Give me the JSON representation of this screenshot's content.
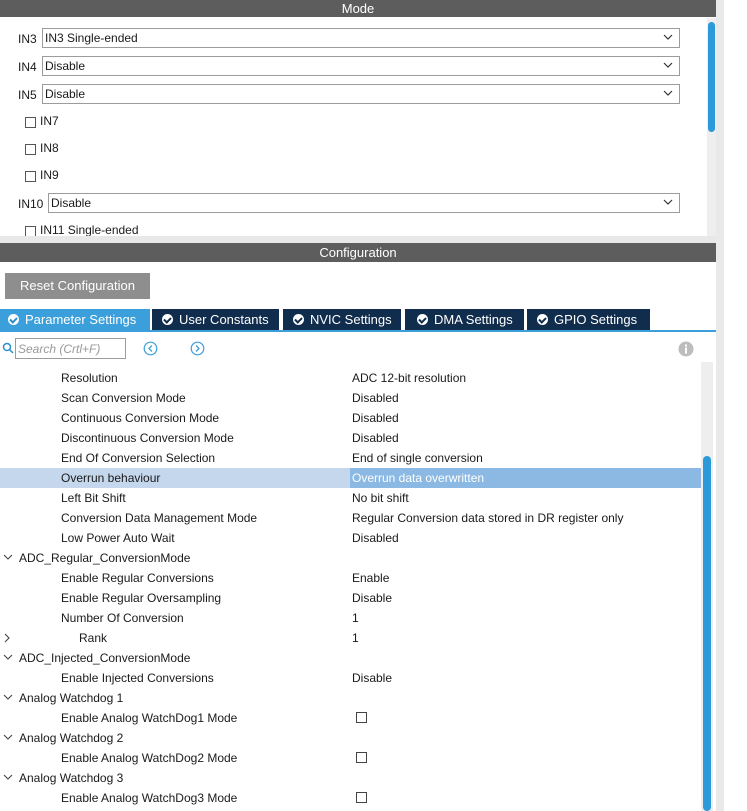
{
  "mode": {
    "title": "Mode",
    "selects": [
      {
        "label": "IN3",
        "value": "IN3 Single-ended"
      },
      {
        "label": "IN4",
        "value": "Disable"
      },
      {
        "label": "IN5",
        "value": "Disable"
      },
      {
        "label": "IN10",
        "value": "Disable"
      }
    ],
    "checkboxes": [
      {
        "label": "IN7",
        "checked": false
      },
      {
        "label": "IN8",
        "checked": false
      },
      {
        "label": "IN9",
        "checked": false
      },
      {
        "label": "IN11 Single-ended",
        "checked": false
      }
    ]
  },
  "config": {
    "title": "Configuration",
    "reset_label": "Reset Configuration",
    "tabs": [
      {
        "label": "Parameter Settings",
        "active": true
      },
      {
        "label": "User Constants",
        "active": false
      },
      {
        "label": "NVIC Settings",
        "active": false
      },
      {
        "label": "DMA Settings",
        "active": false
      },
      {
        "label": "GPIO Settings",
        "active": false
      }
    ],
    "search_placeholder": "Search (Crtl+F)"
  },
  "params": [
    {
      "name": "Resolution",
      "value": "ADC 12-bit resolution"
    },
    {
      "name": "Scan Conversion Mode",
      "value": "Disabled"
    },
    {
      "name": "Continuous Conversion Mode",
      "value": "Disabled"
    },
    {
      "name": "Discontinuous Conversion Mode",
      "value": "Disabled"
    },
    {
      "name": "End Of Conversion Selection",
      "value": "End of single conversion"
    },
    {
      "name": "Overrun behaviour",
      "value": "Overrun data overwritten",
      "selected": true
    },
    {
      "name": "Left Bit Shift",
      "value": "No bit shift"
    },
    {
      "name": "Conversion Data Management Mode",
      "value": "Regular Conversion data stored in DR register only"
    },
    {
      "name": "Low Power Auto Wait",
      "value": "Disabled"
    },
    {
      "group": "ADC_Regular_ConversionMode",
      "expanded": true
    },
    {
      "name": "Enable Regular Conversions",
      "value": "Enable"
    },
    {
      "name": "Enable Regular Oversampling",
      "value": "Disable"
    },
    {
      "name": "Number Of Conversion",
      "value": "1"
    },
    {
      "subgroup": "Rank",
      "value": "1",
      "expanded": false
    },
    {
      "group": "ADC_Injected_ConversionMode",
      "expanded": true
    },
    {
      "name": "Enable Injected Conversions",
      "value": "Disable"
    },
    {
      "group": "Analog Watchdog 1",
      "expanded": true
    },
    {
      "name": "Enable Analog WatchDog1 Mode",
      "checkbox": true,
      "checked": false
    },
    {
      "group": "Analog Watchdog 2",
      "expanded": true
    },
    {
      "name": "Enable Analog WatchDog2 Mode",
      "checkbox": true,
      "checked": false
    },
    {
      "group": "Analog Watchdog 3",
      "expanded": true
    },
    {
      "name": "Enable Analog WatchDog3 Mode",
      "checkbox": true,
      "checked": false
    }
  ],
  "colors": {
    "accent": "#3b9fdb",
    "tab_navy": "#112d4e",
    "title_bar": "#5d5d5d",
    "selected_row": "#c4d7ec"
  }
}
